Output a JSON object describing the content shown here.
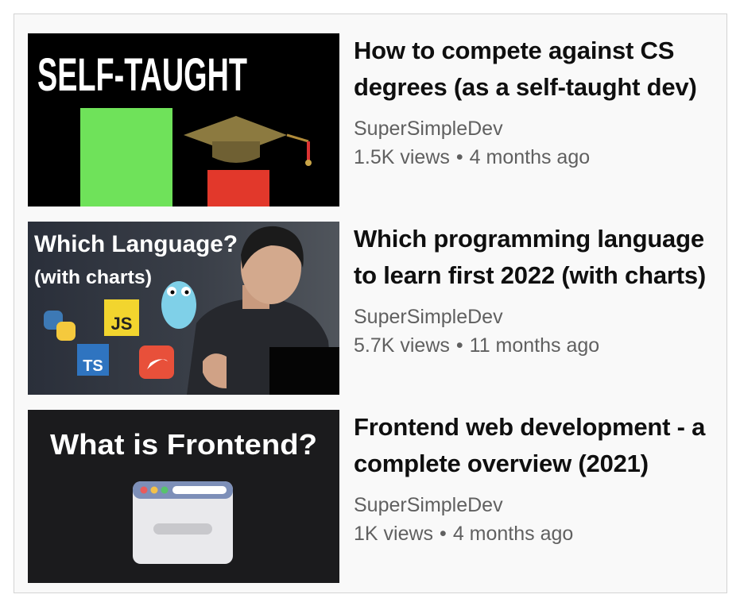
{
  "videos": [
    {
      "title": "How to compete against CS degrees (as a self-taught dev)",
      "channel": "SuperSimpleDev",
      "views": "1.5K views",
      "age": "4 months ago",
      "thumb_text": "SELF-TAUGHT"
    },
    {
      "title": "Which programming language to learn first 2022 (with charts)",
      "channel": "SuperSimpleDev",
      "views": "5.7K views",
      "age": "11 months ago",
      "thumb_text": "Which Language?",
      "thumb_subtext": "(with charts)",
      "badges": [
        "JS",
        "TS"
      ]
    },
    {
      "title": "Frontend web development - a complete overview (2021)",
      "channel": "SuperSimpleDev",
      "views": "1K views",
      "age": "4 months ago",
      "thumb_text": "What is Frontend?"
    }
  ],
  "separator": "•"
}
